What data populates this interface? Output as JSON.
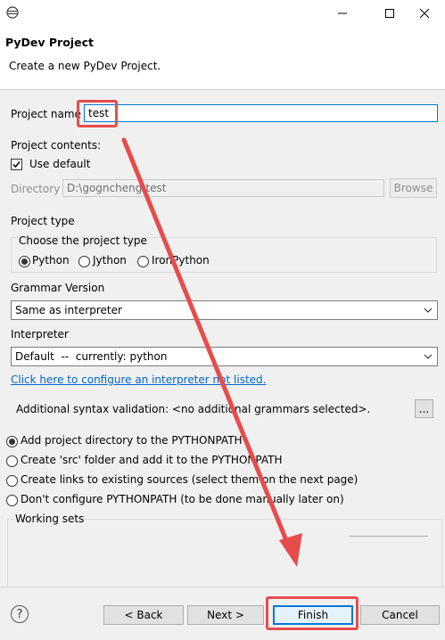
{
  "window": {
    "app_icon": "eclipse-icon",
    "controls": [
      "minimize-icon",
      "maximize-icon",
      "close-icon"
    ]
  },
  "header": {
    "title": "PyDev Project",
    "description": "Create a new PyDev Project."
  },
  "project_name": {
    "label": "Project name",
    "value": "test"
  },
  "project_contents": {
    "label": "Project contents:",
    "use_default_label": "Use default",
    "use_default_checked": true,
    "directory_label": "Directory",
    "directory_value": "D:\\gogncheng\\test",
    "browse_label": "Browse"
  },
  "project_type": {
    "label": "Project type",
    "group_label": "Choose the project type",
    "options": [
      "Python",
      "Jython",
      "IronPython"
    ],
    "selected": "Python"
  },
  "grammar": {
    "label": "Grammar Version",
    "value": "Same as interpreter"
  },
  "interpreter": {
    "label": "Interpreter",
    "value": "Default  --  currently: python",
    "configure_link": "Click here to configure an interpreter not listed."
  },
  "syntax": {
    "label": "Additional syntax validation: <no additional grammars selected>.",
    "button": "..."
  },
  "pythonpath": {
    "options": [
      "Add project directory to the PYTHONPATH",
      "Create 'src' folder and add it to the PYTHONPATH",
      "Create links to existing sources (select them on the next page)",
      "Don't configure PYTHONPATH (to be done manually later on)"
    ],
    "selected_index": 0
  },
  "working_sets": {
    "label": "Working sets"
  },
  "footer": {
    "help_icon": "help-icon",
    "back": "< Back",
    "next": "Next >",
    "finish": "Finish",
    "cancel": "Cancel"
  },
  "annotation": {
    "color": "#e74c4c"
  }
}
